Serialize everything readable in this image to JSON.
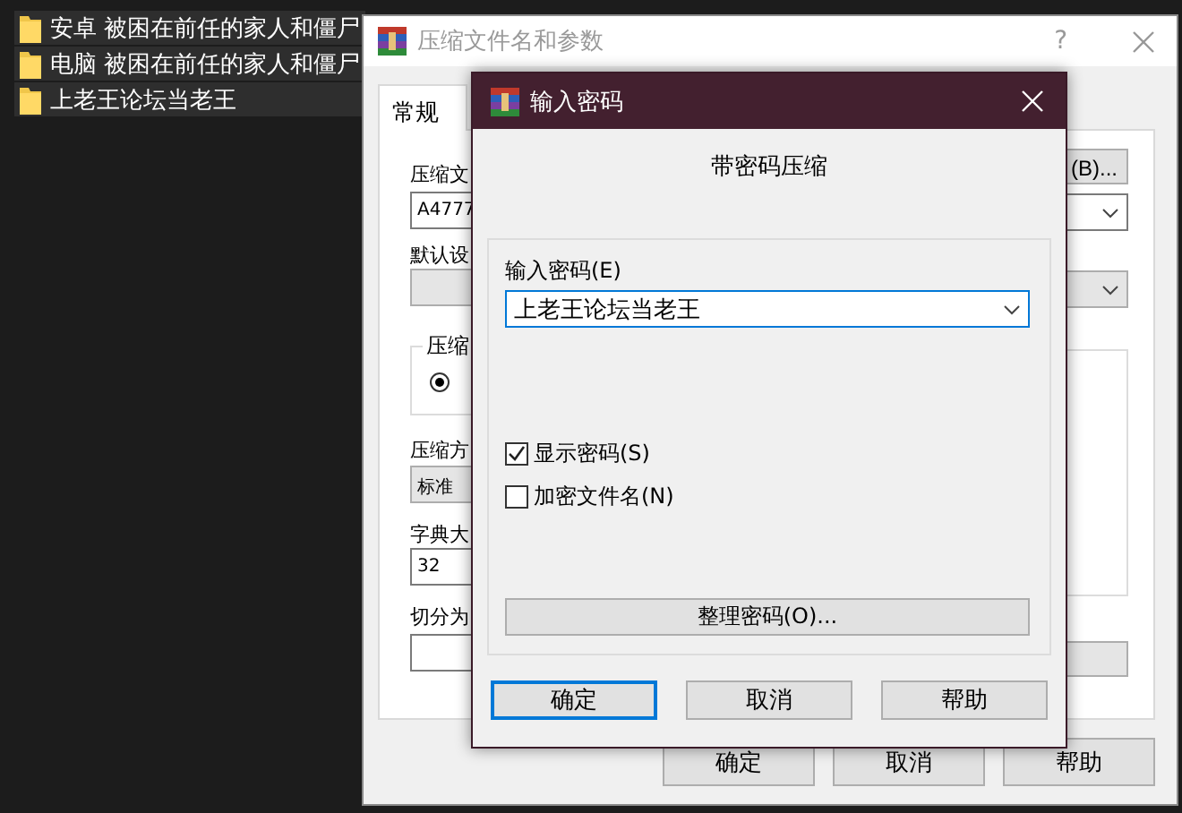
{
  "file_list": [
    {
      "name": "安卓 被困在前任的家人和僵尸"
    },
    {
      "name": "电脑 被困在前任的家人和僵尸"
    },
    {
      "name": "上老王论坛当老王"
    }
  ],
  "back_window": {
    "title": "压缩文件名和参数",
    "help": "?",
    "tabs": [
      {
        "label": "常规",
        "selected": true
      }
    ],
    "archive_name_label": "压缩文",
    "archive_name": "A4777",
    "browse_button": "(B)...",
    "profile_label": "默认设",
    "update_group_label": "压缩",
    "update_radio": {
      "selected": true
    },
    "method_label": "压缩方",
    "method": "标准",
    "dictionary_label": "字典大",
    "dictionary": "32",
    "split_label": "切分为",
    "buttons": [
      "确定",
      "取消",
      "帮助"
    ]
  },
  "dialog": {
    "title": "输入密码",
    "heading": "带密码压缩",
    "password_label": "输入密码(E)",
    "password": "上老王论坛当老王",
    "options": [
      {
        "label": "显示密码(S)",
        "checked": true
      },
      {
        "label": "加密文件名(N)",
        "checked": false
      }
    ],
    "organize_button": "整理密码(O)...",
    "buttons": [
      {
        "label": "确定",
        "default": true
      },
      {
        "label": "取消",
        "default": false
      },
      {
        "label": "帮助",
        "default": false
      }
    ]
  }
}
